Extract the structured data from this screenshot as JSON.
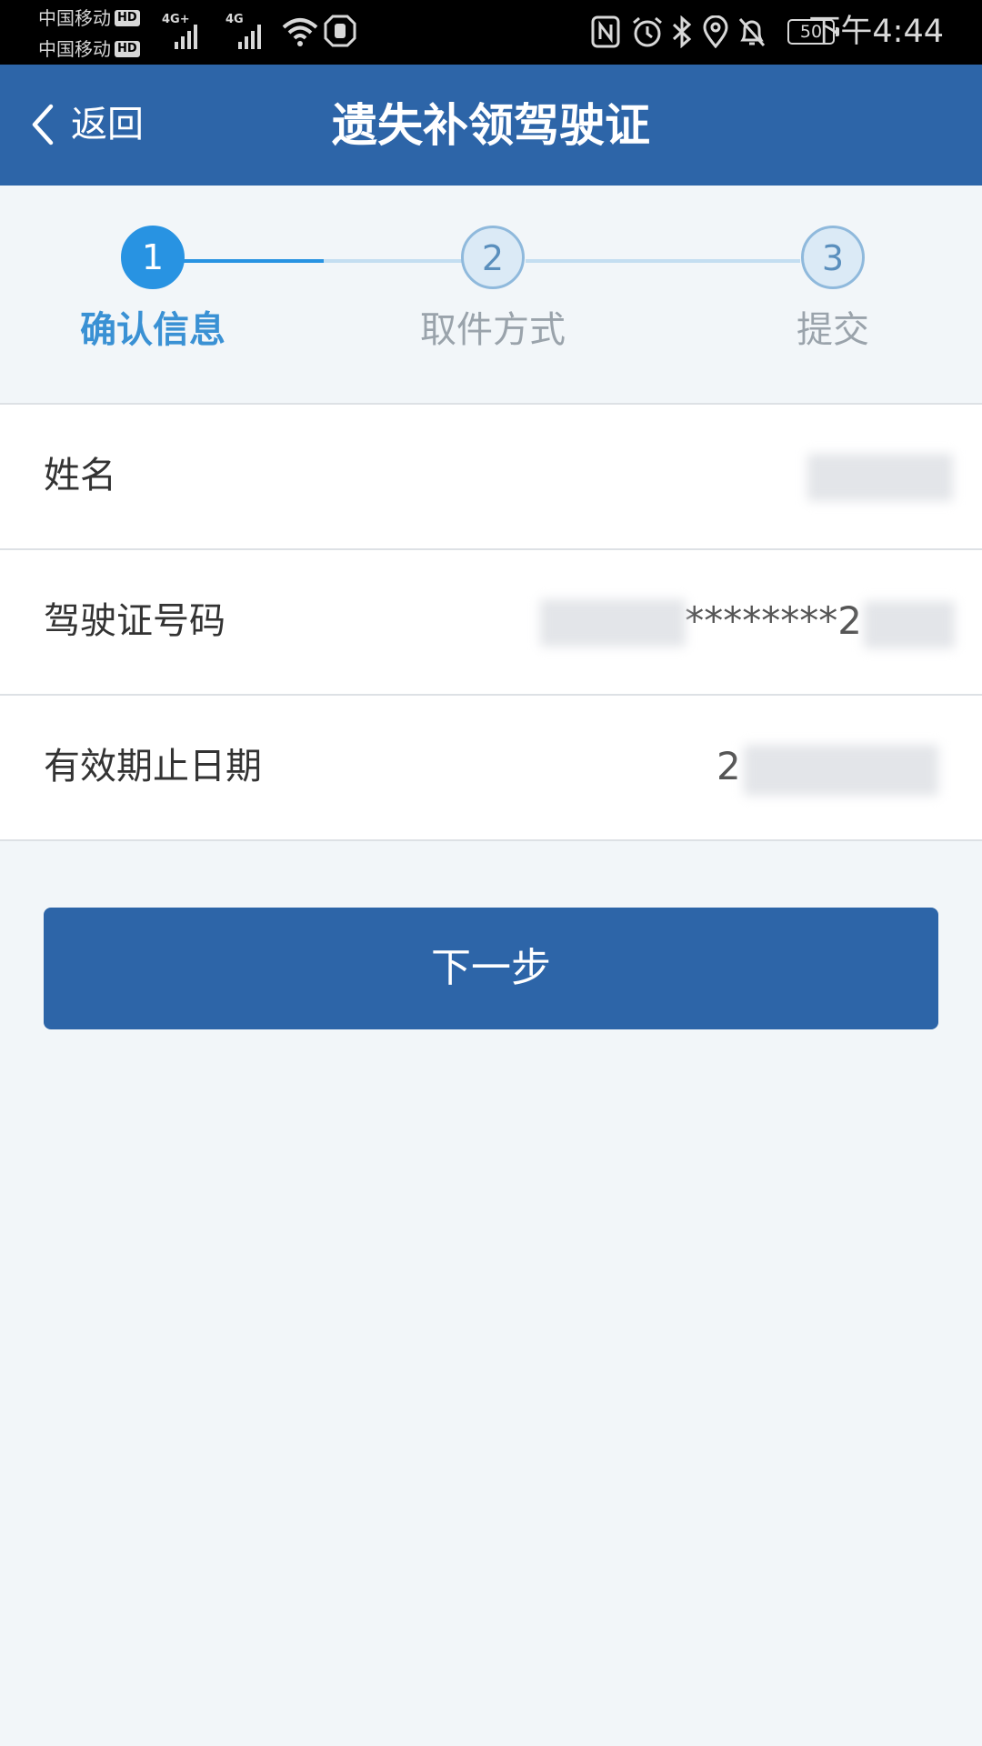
{
  "status_bar": {
    "carriers": [
      "中国移动",
      "中国移动"
    ],
    "carrier_badge": "HD",
    "network_labels": [
      "4G+",
      "4G"
    ],
    "battery_level": "50",
    "time": "下午4:44"
  },
  "header": {
    "back_label": "返回",
    "title": "遗失补领驾驶证"
  },
  "steps": [
    {
      "number": "1",
      "label": "确认信息",
      "state": "active"
    },
    {
      "number": "2",
      "label": "取件方式",
      "state": "inactive"
    },
    {
      "number": "3",
      "label": "提交",
      "state": "inactive"
    }
  ],
  "rows": [
    {
      "label": "姓名",
      "value": ""
    },
    {
      "label": "驾驶证号码",
      "value": "********2"
    },
    {
      "label": "有效期止日期",
      "value": "2"
    }
  ],
  "next_button": {
    "label": "下一步"
  },
  "colors": {
    "header_bg": "#2d65a8",
    "active_step": "#2893e2",
    "page_bg": "#f2f6f9"
  }
}
